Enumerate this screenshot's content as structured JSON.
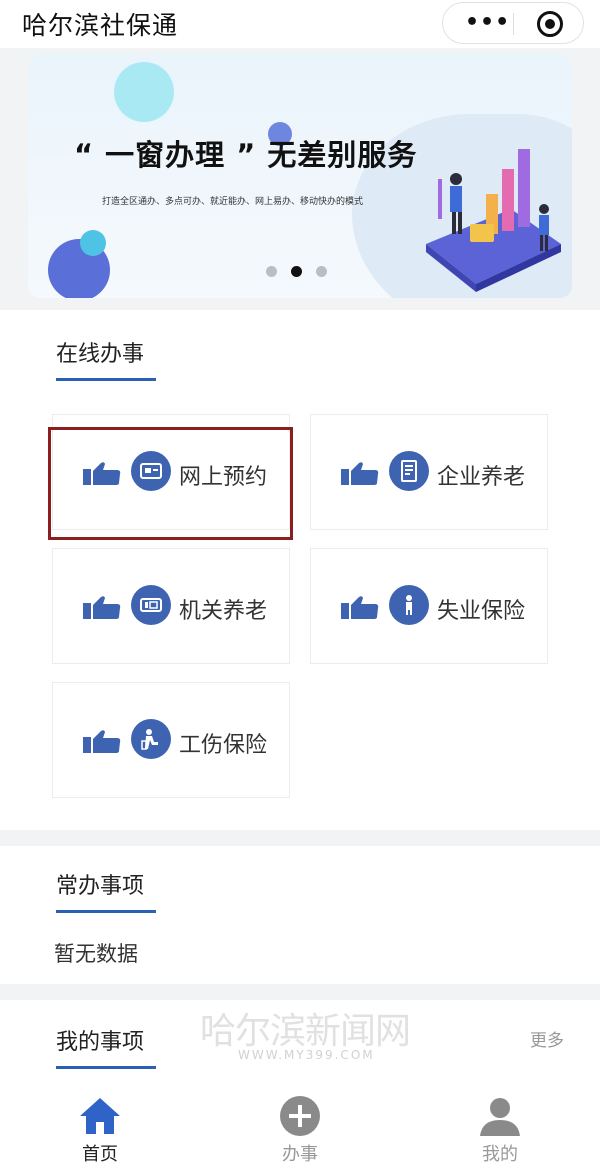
{
  "app": {
    "title": "哈尔滨社保通",
    "capsule_more": "•••"
  },
  "banner": {
    "headline": "“ 一窗办理 ” 无差别服务",
    "tagline": "打造全区通办、多点可办、就近能办、网上易办、移动快办的模式",
    "slides": 3,
    "active_slide": 2
  },
  "online_services": {
    "title": "在线办事",
    "tiles": [
      {
        "label": "网上预约",
        "icon": "id-card-icon"
      },
      {
        "label": "企业养老",
        "icon": "document-icon"
      },
      {
        "label": "机关养老",
        "icon": "id-card-icon"
      },
      {
        "label": "失业保险",
        "icon": "person-icon"
      },
      {
        "label": "工伤保险",
        "icon": "injury-icon"
      }
    ]
  },
  "frequent": {
    "title": "常办事项",
    "empty": "暂无数据"
  },
  "my_items": {
    "title": "我的事项",
    "more": "更多"
  },
  "watermark": {
    "main": "哈尔滨新闻网",
    "sub": "WWW.MY399.COM"
  },
  "tabbar": {
    "items": [
      {
        "label": "首页",
        "icon": "home-icon",
        "active": true
      },
      {
        "label": "办事",
        "icon": "plus-circle-icon",
        "active": false
      },
      {
        "label": "我的",
        "icon": "user-icon",
        "active": false
      }
    ]
  },
  "colors": {
    "accent": "#2a61b5",
    "icon_blue": "#3d63b1",
    "highlight": "#8b1f1f"
  }
}
